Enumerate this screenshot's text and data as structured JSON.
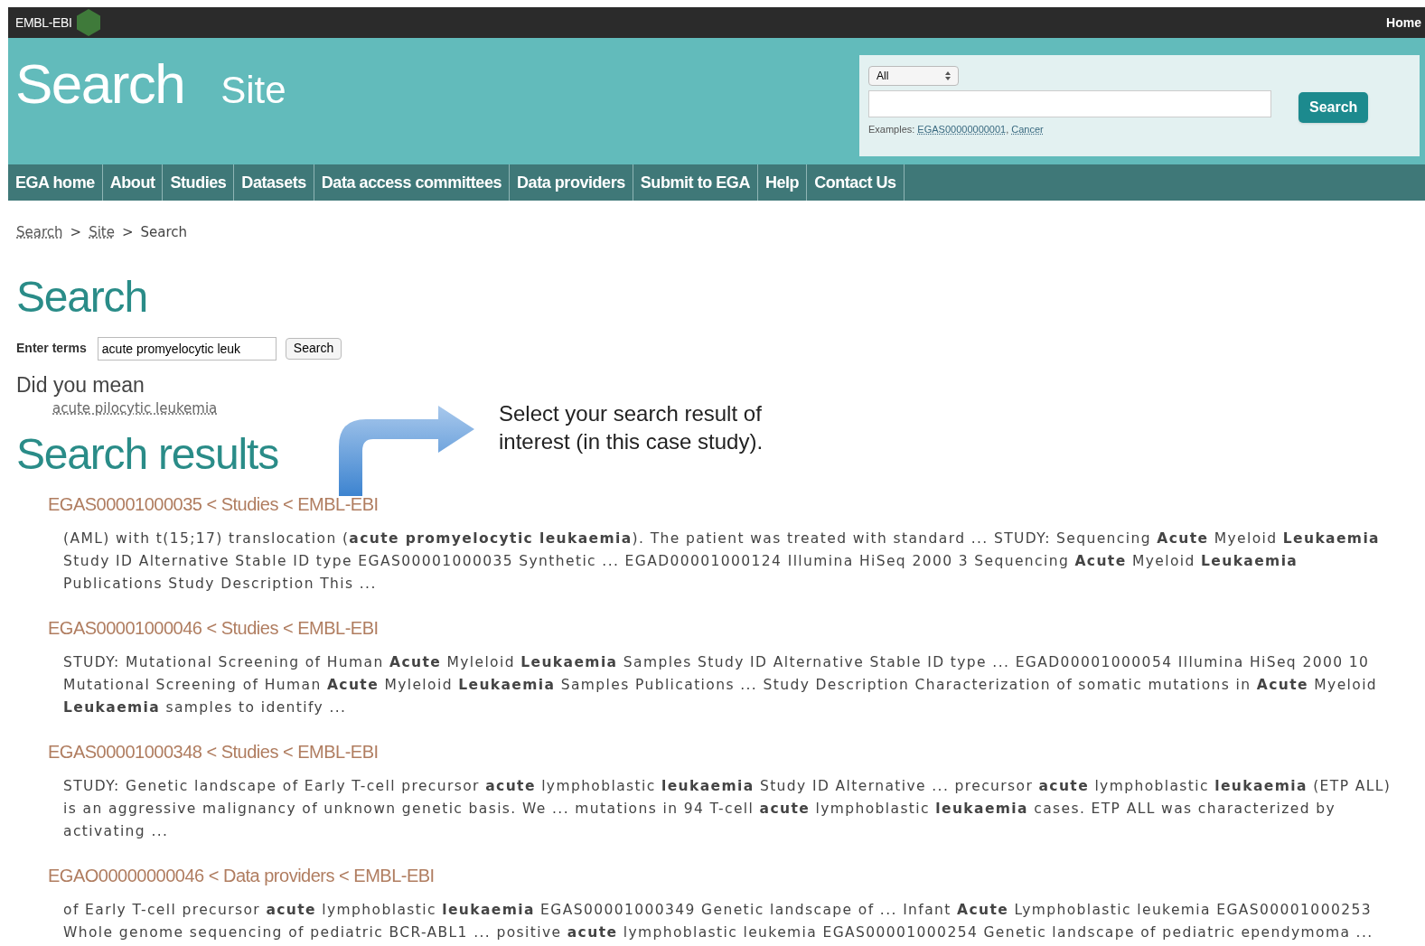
{
  "top_bar": {
    "logo_text": "EMBL-EBI",
    "home_link": "Home"
  },
  "header": {
    "title": "Search",
    "subtitle": "Site",
    "search": {
      "scope": "All",
      "button": "Search",
      "examples_label": "Examples:",
      "examples": [
        "EGAS00000000001",
        "Cancer"
      ],
      "examples_separator": ","
    }
  },
  "nav": [
    {
      "label": "EGA home"
    },
    {
      "label": "About"
    },
    {
      "label": "Studies"
    },
    {
      "label": "Datasets"
    },
    {
      "label": "Data access committees"
    },
    {
      "label": "Data providers"
    },
    {
      "label": "Submit to EGA"
    },
    {
      "label": "Help"
    },
    {
      "label": "Contact Us"
    }
  ],
  "breadcrumb": [
    {
      "label": "Search",
      "link": true
    },
    {
      "label": "Site",
      "link": true
    },
    {
      "label": "Search",
      "link": false
    }
  ],
  "breadcrumb_separator": ">",
  "page_title": "Search",
  "search_form": {
    "label": "Enter terms",
    "value": "acute promyelocytic leuk",
    "button": "Search"
  },
  "did_you_mean": {
    "heading": "Did you mean",
    "suggestion": "acute pilocytic leukemia"
  },
  "annotation": {
    "text": "Select your search result of interest (in this case study)."
  },
  "results_heading": "Search results",
  "results": [
    {
      "title": "EGAS00001000035 < Studies < EMBL-EBI",
      "snippet": "(AML) with t(15;17) translocation (**acute promyelocytic leukaemia**). The patient was treated with standard ... STUDY: Sequencing **Acute** Myeloid **Leukaemia** Study ID Alternative Stable ID type EGAS00001000035 Synthetic ... EGAD00001000124 Illumina HiSeq 2000 3 Sequencing **Acute** Myeloid **Leukaemia** Publications Study Description This ..."
    },
    {
      "title": "EGAS00001000046 < Studies < EMBL-EBI",
      "snippet": "STUDY: Mutational Screening of Human **Acute** Myleloid **Leukaemia** Samples Study ID Alternative Stable ID type ... EGAD00001000054 Illumina HiSeq 2000 10 Mutational Screening of Human **Acute** Myleloid **Leukaemia** Samples Publications ... Study Description Characterization of somatic mutations in **Acute** Myeloid **Leukaemia** samples to identify ..."
    },
    {
      "title": "EGAS00001000348 < Studies < EMBL-EBI",
      "snippet": "STUDY: Genetic landscape of Early T-cell precursor **acute** lymphoblastic **leukaemia** Study ID Alternative ... precursor **acute** lymphoblastic **leukaemia** (ETP ALL) is an aggressive malignancy of unknown genetic basis. We ... mutations in 94 T-cell **acute** lymphoblastic **leukaemia** cases. ETP ALL was characterized by activating ..."
    },
    {
      "title": "EGAO00000000046 < Data providers < EMBL-EBI",
      "snippet": "of Early T-cell precursor **acute** lymphoblastic **leukaemia** EGAS00001000349 Genetic landscape of ... Infant **Acute** Lymphoblastic leukemia EGAS00001000253 Whole genome sequencing of pediatric BCR-ABL1 ... positive **acute** lymphoblastic leukemia EGAS00001000254 Genetic landscape of pediatric ependymoma ..."
    }
  ]
}
